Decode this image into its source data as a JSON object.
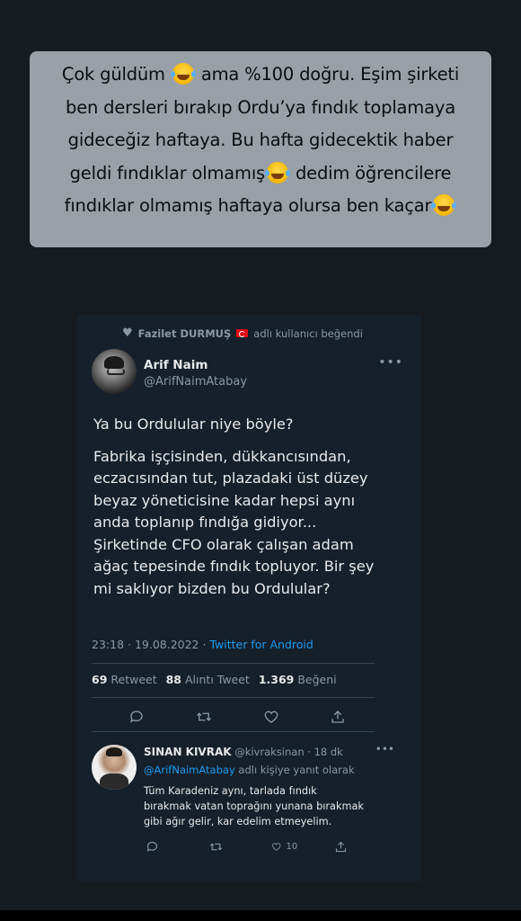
{
  "caption": {
    "line1_a": "Çok güldüm",
    "line1_b": "ama %100 doğru. Eşim şirketi",
    "line2": "ben dersleri bırakıp Ordu’ya fındık toplamaya",
    "line3": "gideceğiz haftaya. Bu hafta gidecektik haber",
    "line4_a": "geldi fındıklar olmamış",
    "line4_b": "dedim öğrencilere",
    "line5": "fındıklar olmamış haftaya olursa ben kaçar",
    "emoji_icon": "face-with-tears-of-joy-icon"
  },
  "tweet": {
    "liked_by_name": "Fazilet DURMUŞ",
    "liked_by_suffix": "adlı kullanıcı beğendi",
    "author_name": "Arif Naim",
    "author_handle": "@ArifNaimAtabay",
    "text_first": "Ya bu Ordulular niye böyle?",
    "text_lines": [
      "Fabrika işçisinden, dükkancısından,",
      "eczacısından tut, plazadaki üst düzey",
      "beyaz yöneticisine kadar hepsi aynı",
      "anda toplanıp fındığa gidiyor...",
      "Şirketinde CFO olarak çalışan adam",
      "ağaç tepesinde fındık topluyor. Bir şey",
      "mi saklıyor bizden bu Ordulular?"
    ],
    "time_date": "23:18 · 19.08.2022 · ",
    "client": "Twitter for Android",
    "retweets": "69",
    "retweets_label": "Retweet",
    "quotes": "88",
    "quotes_label": "Alıntı Tweet",
    "likes": "1.369",
    "likes_label": "Beğeni"
  },
  "reply": {
    "name": "SINAN KIVRAK",
    "handle_time": "@kivraksinan · 18 dk",
    "reply_mention": "@ArifNaimAtabay",
    "reply_suffix": " adlı kişiye yanıt olarak",
    "text_lines": [
      "Tüm Karadeniz aynı, tarlada fındık",
      "bırakmak vatan toprağını yunana bırakmak",
      "gibi ağır gelir, kar edelim etmeyelim."
    ],
    "like_count": "10"
  },
  "colors": {
    "background": "#161b22",
    "caption_bg": "#9aa0a8",
    "tweet_bg": "#15202b",
    "link": "#1d9bf0",
    "muted": "#8b98a5"
  }
}
